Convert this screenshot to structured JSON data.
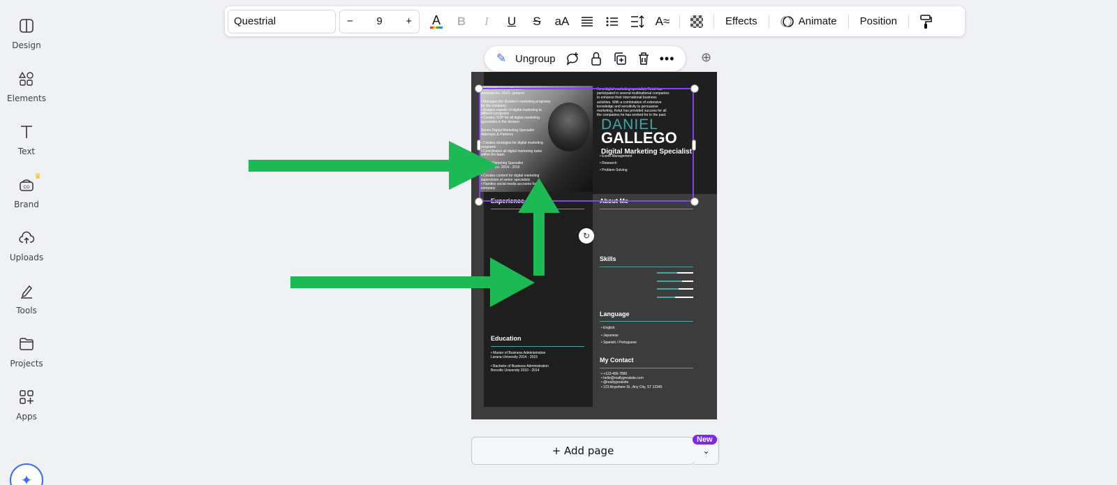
{
  "sidebar": {
    "items": [
      {
        "label": "Design",
        "icon": "design-icon"
      },
      {
        "label": "Elements",
        "icon": "elements-icon"
      },
      {
        "label": "Text",
        "icon": "text-icon"
      },
      {
        "label": "Brand",
        "icon": "brand-icon"
      },
      {
        "label": "Uploads",
        "icon": "uploads-icon"
      },
      {
        "label": "Tools",
        "icon": "tools-icon"
      },
      {
        "label": "Projects",
        "icon": "projects-icon"
      },
      {
        "label": "Apps",
        "icon": "apps-icon"
      }
    ]
  },
  "toolbar": {
    "font": "Questrial",
    "font_size": "9",
    "minus": "−",
    "plus": "+",
    "effects": "Effects",
    "animate": "Animate",
    "position": "Position"
  },
  "context_menu": {
    "ungroup": "Ungroup"
  },
  "resume": {
    "name_first": "DANIEL",
    "name_last": "GALLEGO",
    "role": "Digital Marketing Specialist",
    "intro": [
      "As a digital marketing specialist, Ketut has",
      "participated in several multinational companies",
      "to enhance their international business",
      "activities. With a combination of extensive",
      "knowledge and sensitivity to persuasive",
      "marketing, Ketut has provided success for all",
      "the companies he has worked for in the past."
    ],
    "exp_lines": [
      "Head of Marketing Division",
      "Arowwai Inc. 2018 - present",
      "",
      "• Manages the division's marketing programs",
      "   for the company",
      "• Assigns experts of digital marketing to",
      "   different programs",
      "• Creates SOP for all digital marketing",
      "   specialists in the division",
      "",
      "Senior Digital Marketing Specialist",
      "Aldenaire & Partners",
      "",
      "• Creates strategies for digital marketing",
      "   programs",
      "• Coordinates all digital marketing tasks",
      "   within the team",
      "",
      "Digital Marketing Specialist",
      "Borcelle Inc. 2014 - 2016",
      "",
      "• Creates content for digital marketing",
      "   supervision of senior specialists",
      "• Handles social media accounts for the",
      "   company"
    ],
    "skills_list": [
      "• Event Management",
      "• Research",
      "• Problem Solving"
    ],
    "experience_heading": "Experience",
    "about_heading": "About Me",
    "skills_heading": "Skills",
    "language_heading": "Language",
    "languages": [
      "• English",
      "• Japanese",
      "• Spanish / Portuguese"
    ],
    "contact_heading": "My Contact",
    "contacts": [
      "• +123-456-7890",
      "• hello@reallygreatsite.com",
      "• @reallygreatsite",
      "• 123 Anywhere St., Any City, ST 12345"
    ],
    "education_heading": "Education",
    "education": [
      "• Master of Business Administration",
      "Larana University 2014 - 2015",
      "",
      "• Bachelor of Business Administration",
      "Borcelle University 2010 - 2014"
    ],
    "skill_levels": [
      0.55,
      0.7,
      0.6,
      0.5
    ]
  },
  "add_page": {
    "label": "+ Add page",
    "badge": "New"
  },
  "colors": {
    "accent": "#8b3dff",
    "teal": "#3fa8a6",
    "arrow": "#1db954"
  }
}
